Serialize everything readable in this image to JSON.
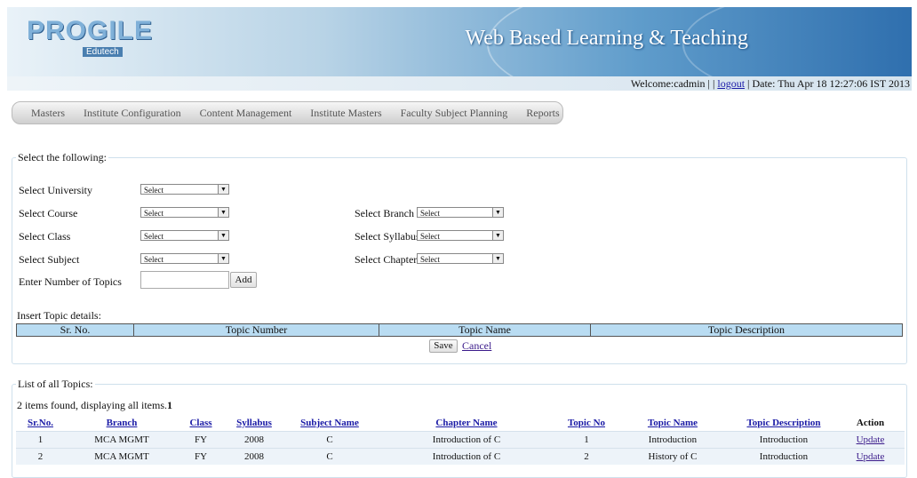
{
  "header": {
    "logo_text": "PROGILE",
    "logo_sub": "Edutech",
    "site_title": "Web Based Learning & Teaching"
  },
  "welcome": {
    "prefix": "Welcome:cadmin | |",
    "logout": "logout",
    "date": "| Date: Thu Apr 18 12:27:06 IST 2013"
  },
  "menu": [
    "Masters",
    "Institute Configuration",
    "Content Management",
    "Institute Masters",
    "Faculty Subject Planning",
    "Reports"
  ],
  "form": {
    "legend": "Select the following:",
    "university_label": "Select University",
    "course_label": "Select Course",
    "class_label": "Select Class",
    "subject_label": "Select Subject",
    "branch_label": "Select Branch",
    "syllabus_label": "Select Syllabus",
    "chapter_label": "Select Chapter",
    "topics_label": "Enter Number of Topics",
    "select_value": "Select",
    "add_label": "Add",
    "insert_label": "Insert Topic details:",
    "columns": [
      "Sr. No.",
      "Topic Number",
      "Topic Name",
      "Topic Description"
    ],
    "save_label": "Save",
    "cancel_label": "Cancel"
  },
  "list": {
    "legend": "List of all Topics:",
    "summary": "2 items found, displaying all items.",
    "page": "1",
    "columns": [
      "Sr.No.",
      "Branch",
      "Class",
      "Syllabus",
      "Subject Name",
      "Chapter Name",
      "Topic No",
      "Topic Name",
      "Topic Description",
      "Action"
    ],
    "rows": [
      [
        "1",
        "MCA MGMT",
        "FY",
        "2008",
        "C",
        "Introduction of C",
        "1",
        "Introduction",
        "Introduction",
        "Update"
      ],
      [
        "2",
        "MCA MGMT",
        "FY",
        "2008",
        "C",
        "Introduction of C",
        "2",
        "History of C",
        "Introduction",
        "Update"
      ]
    ]
  },
  "colors": {
    "accent": "#2f6fae",
    "table_header": "#b9dcf2",
    "link": "#1a1aa6"
  }
}
